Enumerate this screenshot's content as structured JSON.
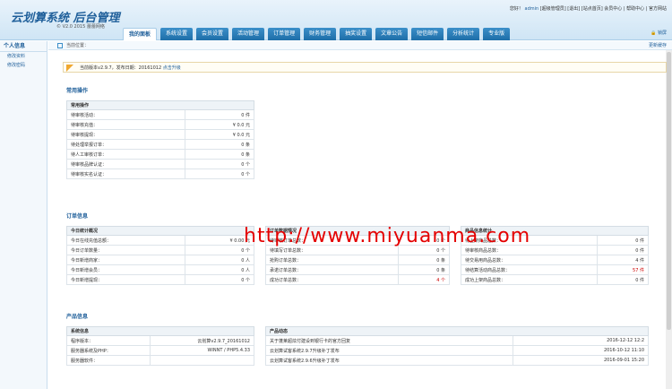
{
  "header": {
    "logo": "云划算系统 后台管理",
    "logo_sub": "© V2.0 2015 蕾蕾网络",
    "topright_prefix": "您好！",
    "user": "admin",
    "links": "[超级管理员] [退出] [站点首页] 会员中心 | 帮助中心 | 官方网站",
    "lock": "锁屏"
  },
  "nav": {
    "tabs": [
      "我的面板",
      "系统设置",
      "会员设置",
      "活动管理",
      "订单管理",
      "财务管理",
      "抽奖设置",
      "文章公告",
      "短信邮件",
      "分析统计",
      "专业版"
    ]
  },
  "sidebar": {
    "title": "个人信息",
    "items": [
      "修改资料",
      "修改密码"
    ]
  },
  "crumb": {
    "label": "当前位置：",
    "more": "更新缓存"
  },
  "version": {
    "text": "当前版本v2.9.7，发布日期：20161012",
    "link": "点击升级"
  },
  "sections": {
    "common": "常用操作",
    "orders": "订单信息",
    "product": "产品信息"
  },
  "common_table": {
    "header": "常用操作",
    "rows": [
      [
        "待审核活动：",
        "0 件"
      ],
      [
        "待审核充值：",
        "¥ 0.0 元"
      ],
      [
        "待审核提现：",
        "¥ 0.0 元"
      ],
      [
        "待处理举报订单：",
        "0 条"
      ],
      [
        "待人工审核订单：",
        "0 条"
      ],
      [
        "待审核品牌认证：",
        "0 个"
      ],
      [
        "待审核实名认证：",
        "0 个"
      ]
    ]
  },
  "today_table": {
    "header": "今日统计概况",
    "rows": [
      [
        "今日在线充值总额：",
        "¥ 0.00 元"
      ],
      [
        "今日订单数量：",
        "0 个"
      ],
      [
        "今日新增商家：",
        "0 人"
      ],
      [
        "今日新增会员：",
        "0 人"
      ],
      [
        "今日新增提现：",
        "0 个"
      ]
    ]
  },
  "order_table": {
    "header": "订单数据情况",
    "rows": [
      [
        "待审核订单总数：",
        "0 个"
      ],
      [
        "待填写订单总数：",
        "0 个"
      ],
      [
        "抢购订单总数：",
        "0 条"
      ],
      [
        "承诺订单总数：",
        "0 条"
      ],
      [
        "成功订单总数：",
        "4 个"
      ]
    ]
  },
  "goods_table": {
    "header": "商品信息统计",
    "rows": [
      [
        "待上架商品总数：",
        "0 件"
      ],
      [
        "待审核商品总数：",
        "0 件"
      ],
      [
        "待交易用商品总数：",
        "4 件"
      ],
      [
        "待结算活动商品总数：",
        "57 件"
      ],
      [
        "成功上架商品总数：",
        "0 件"
      ]
    ]
  },
  "sys_table": {
    "header": "系统信息",
    "rows": [
      [
        "程序版本：",
        "云划算v2.9.7_20161012"
      ],
      [
        "服务器系统及PHP：",
        "WINNT / PHP5.4.33"
      ],
      [
        "服务器软件：",
        ""
      ]
    ]
  },
  "news_table": {
    "header": "产品动态",
    "rows": [
      [
        "关于蓬莱超炫付建设到银行卡的官方回复",
        "2016-12-12 12:2"
      ],
      [
        "云划算试客系统2.9.7升级补丁发布",
        "2016-10-12 11:10"
      ],
      [
        "云划算试客系统2.9.6升级补丁发布",
        "2016-09-01 15:20"
      ]
    ]
  },
  "watermark": "http://www.miyuanma.com",
  "colors": {
    "accent": "#1f5f9a",
    "tab": "#2b7fbb",
    "warn": "#c00000"
  }
}
